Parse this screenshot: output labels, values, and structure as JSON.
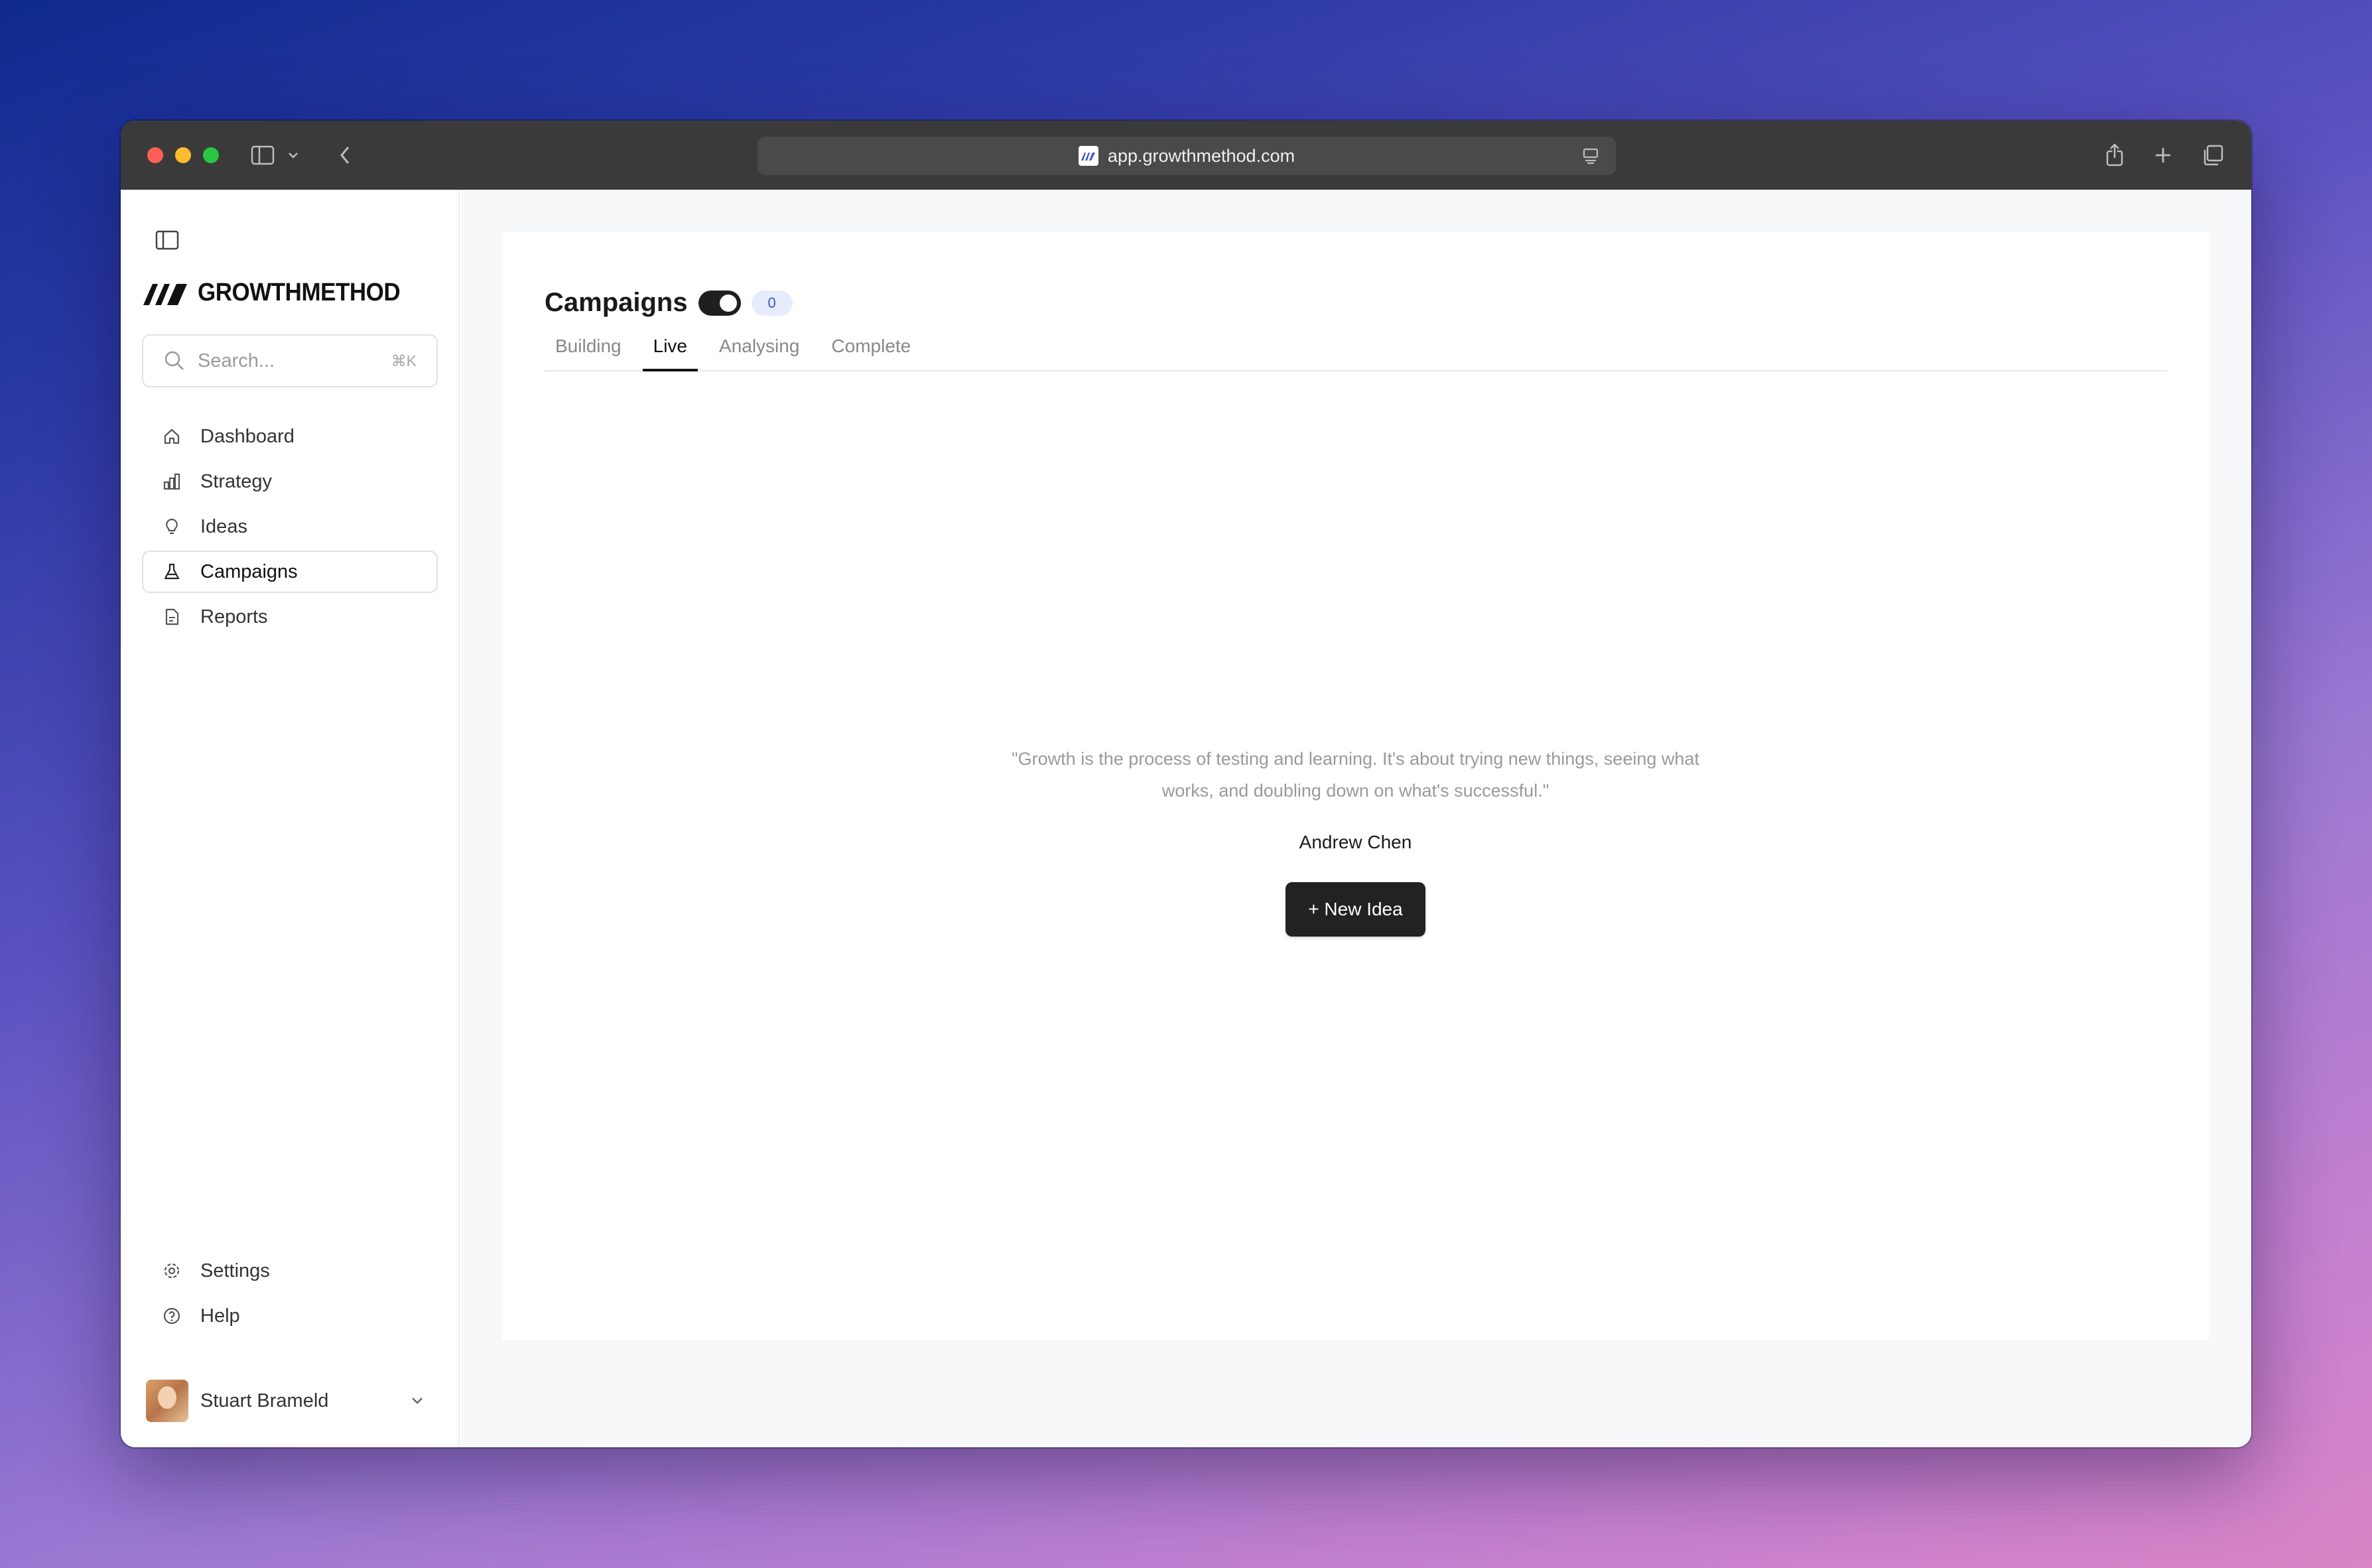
{
  "browser": {
    "url": "app.growthmethod.com"
  },
  "sidebar": {
    "logo_text": "GROWTHMETHOD",
    "search": {
      "placeholder": "Search...",
      "shortcut": "⌘K"
    },
    "items": [
      {
        "label": "Dashboard",
        "icon": "home-icon"
      },
      {
        "label": "Strategy",
        "icon": "bar-chart-icon"
      },
      {
        "label": "Ideas",
        "icon": "lightbulb-icon"
      },
      {
        "label": "Campaigns",
        "icon": "flask-icon",
        "active": true
      },
      {
        "label": "Reports",
        "icon": "document-icon"
      }
    ],
    "bottom_items": [
      {
        "label": "Settings",
        "icon": "gear-icon"
      },
      {
        "label": "Help",
        "icon": "help-circle-icon"
      }
    ],
    "user": {
      "name": "Stuart Brameld"
    }
  },
  "main": {
    "title": "Campaigns",
    "count": "0",
    "tabs": [
      {
        "label": "Building"
      },
      {
        "label": "Live",
        "active": true
      },
      {
        "label": "Analysing"
      },
      {
        "label": "Complete"
      }
    ],
    "empty_state": {
      "quote_line1": "\"Growth is the process of testing and learning. It's about trying new things, seeing what",
      "quote_line2": "works, and doubling down on what's successful.\"",
      "author": "Andrew Chen",
      "button_label": "+ New Idea"
    }
  },
  "colors": {
    "accent_dark": "#222222",
    "badge_bg": "#e6ecfb",
    "badge_text": "#3a57c4"
  }
}
